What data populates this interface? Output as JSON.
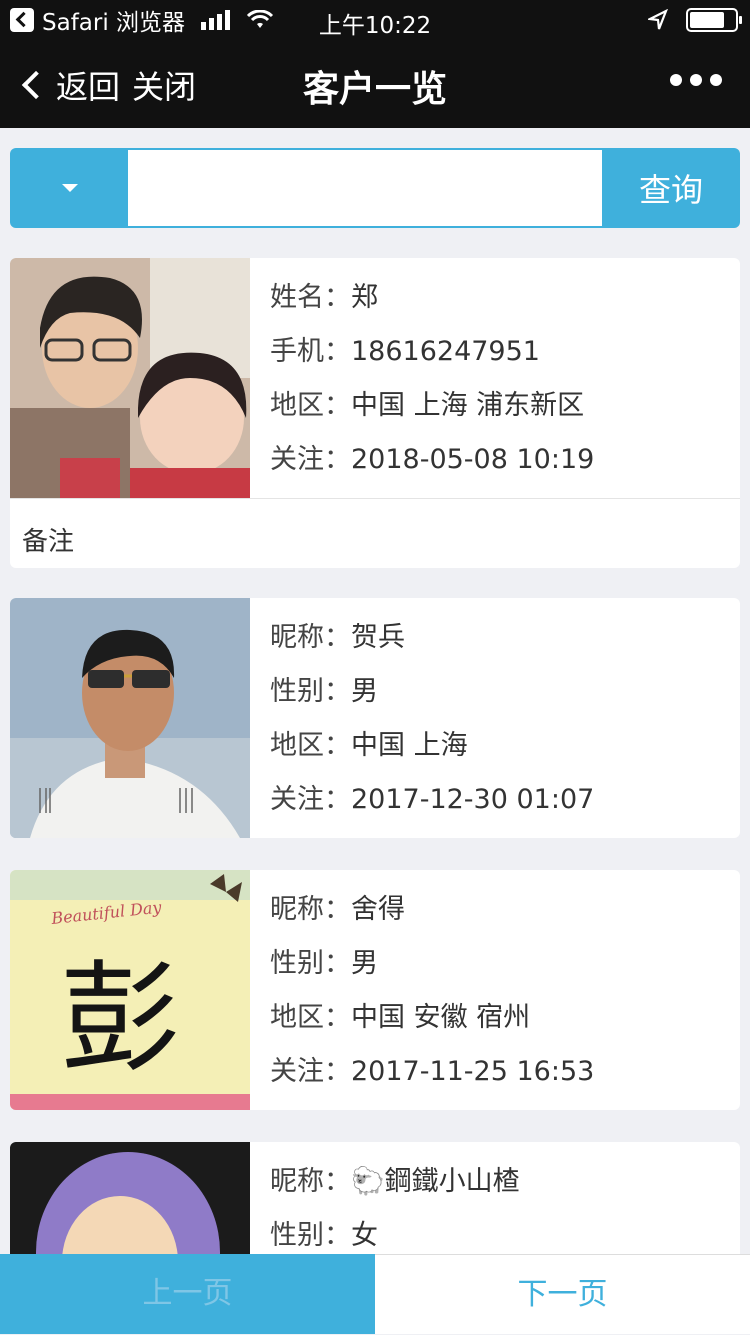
{
  "status": {
    "app": "Safari 浏览器",
    "time": "上午10:22"
  },
  "nav": {
    "back": "返回",
    "close": "关闭",
    "title": "客户一览"
  },
  "search": {
    "input_value": "",
    "button": "查询"
  },
  "customers": [
    {
      "rows": [
        {
          "label": "姓名：",
          "value": "郑"
        },
        {
          "label": "手机：",
          "value": "18616247951"
        },
        {
          "label": "地区：",
          "value": "中国 上海 浦东新区"
        },
        {
          "label": "关注：",
          "value": "2018-05-08 10:19"
        }
      ],
      "note": "备注"
    },
    {
      "rows": [
        {
          "label": "昵称：",
          "value": "贺兵"
        },
        {
          "label": "性别：",
          "value": "男"
        },
        {
          "label": "地区：",
          "value": "中国 上海"
        },
        {
          "label": "关注：",
          "value": "2017-12-30 01:07"
        }
      ]
    },
    {
      "rows": [
        {
          "label": "昵称：",
          "value": "舍得"
        },
        {
          "label": "性别：",
          "value": "男"
        },
        {
          "label": "地区：",
          "value": "中国 安徽 宿州"
        },
        {
          "label": "关注：",
          "value": "2017-11-25 16:53"
        }
      ],
      "photo_text": "Beautiful Day",
      "photo_char": "彭"
    },
    {
      "rows": [
        {
          "label": "昵称：",
          "value": "🐑鋼鐵小山楂"
        },
        {
          "label": "性别：",
          "value": "女"
        }
      ]
    }
  ],
  "pager": {
    "prev": "上一页",
    "next": "下一页"
  },
  "colors": {
    "accent": "#3fb0dc",
    "navbar": "#111111"
  }
}
